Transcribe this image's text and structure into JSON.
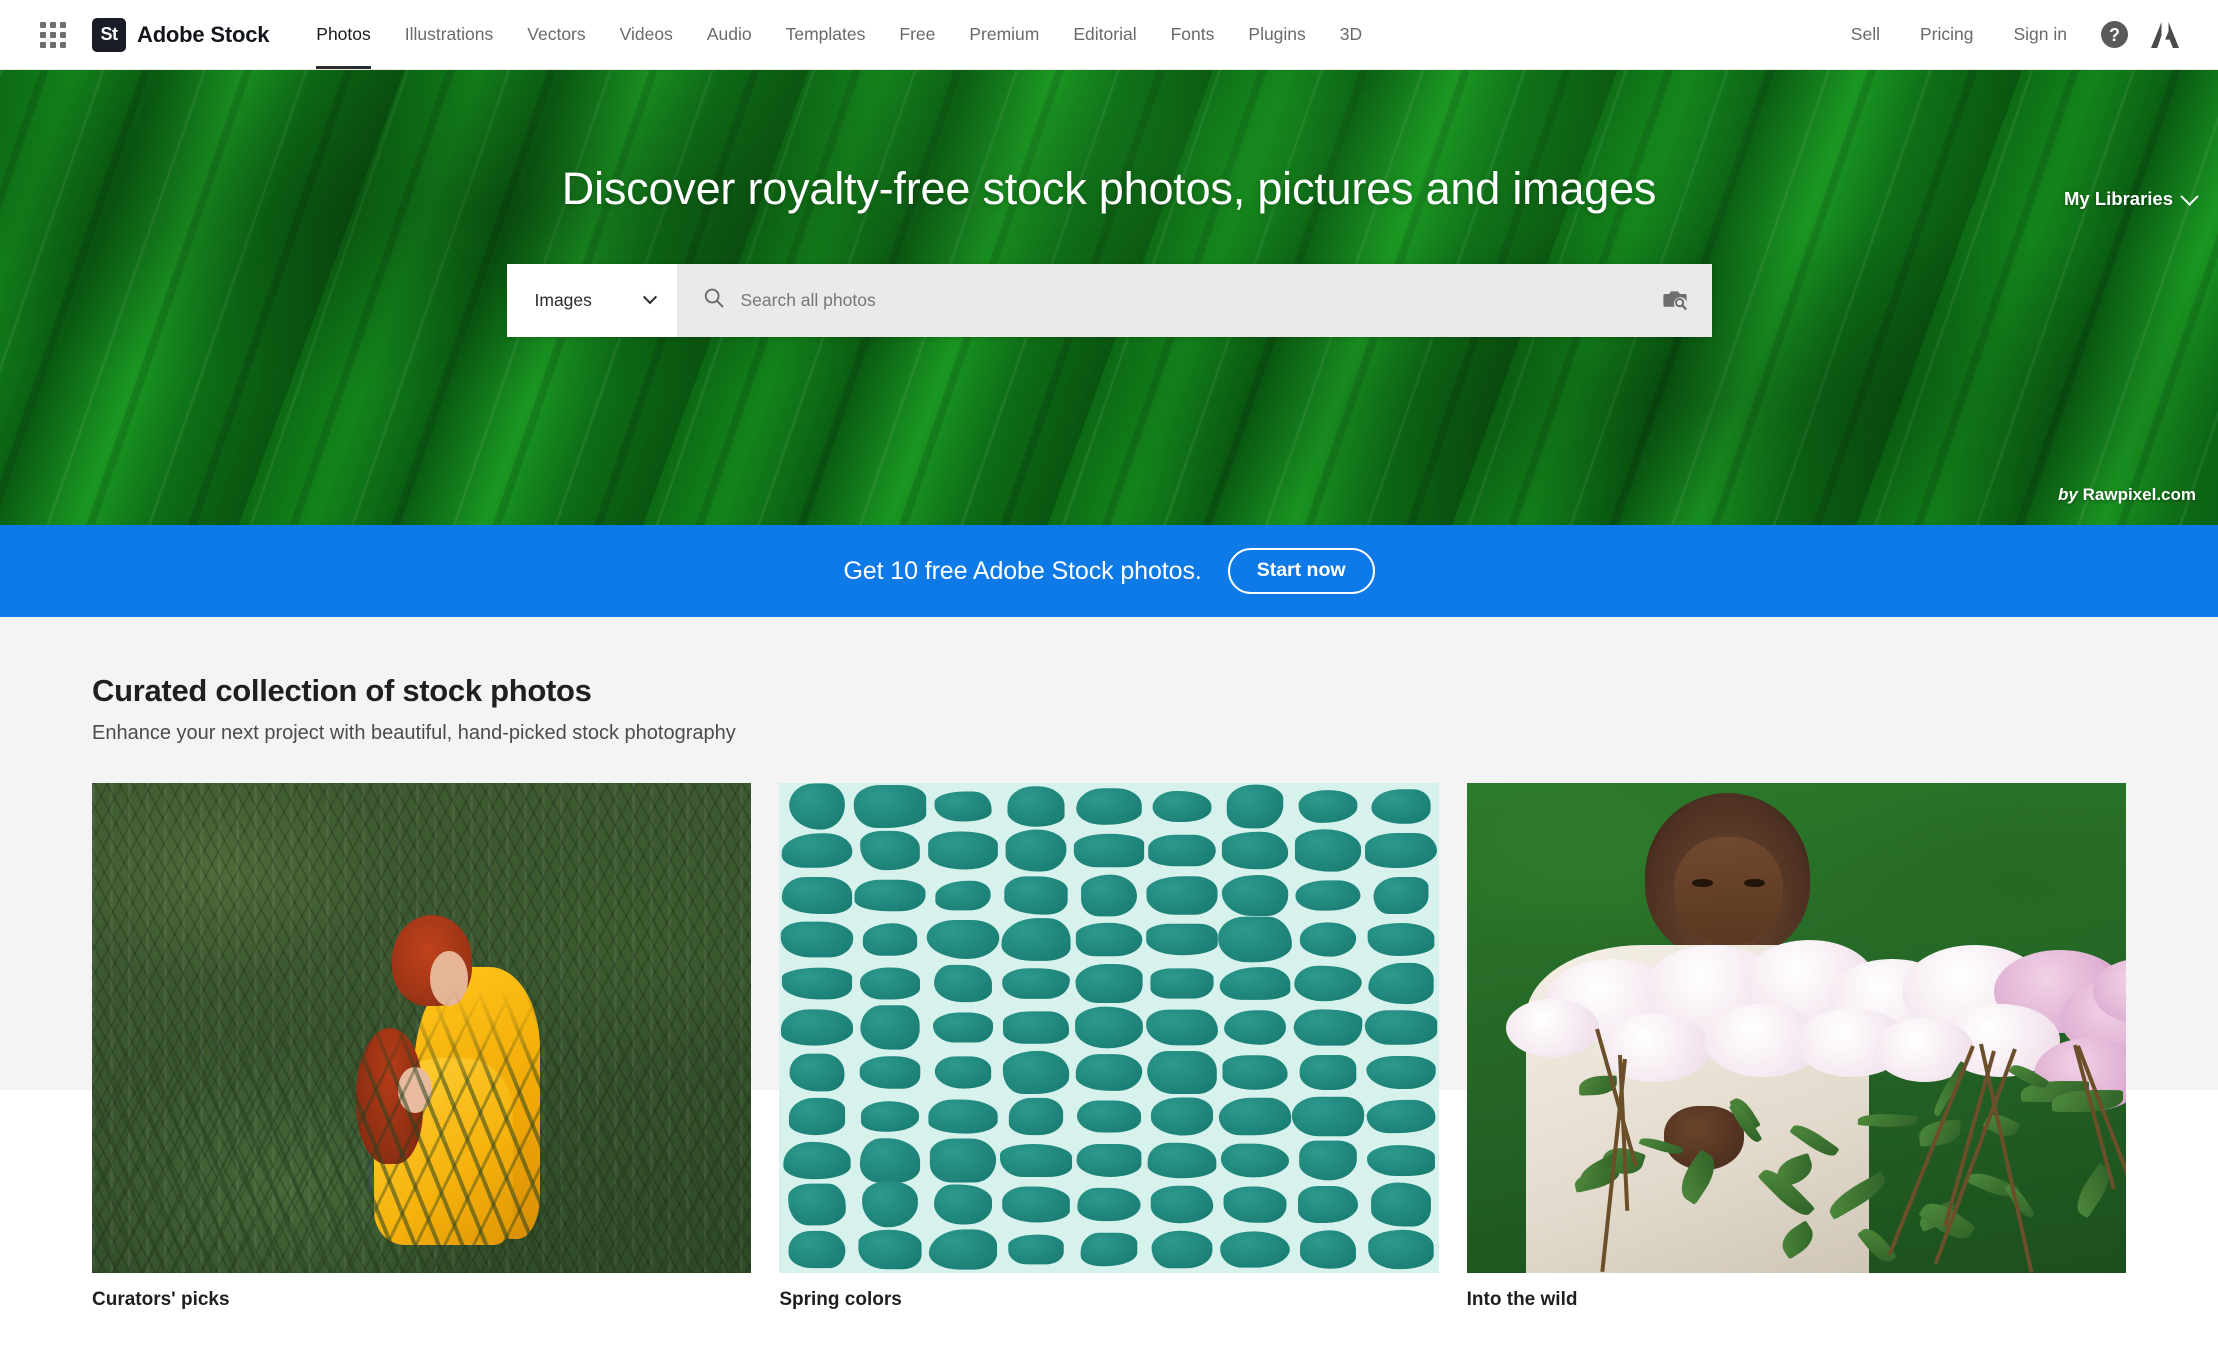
{
  "header": {
    "app_grid_icon": "app-grid-icon",
    "brand": {
      "mark": "St",
      "name": "Adobe Stock"
    },
    "nav": [
      {
        "label": "Photos",
        "active": true
      },
      {
        "label": "Illustrations",
        "active": false
      },
      {
        "label": "Vectors",
        "active": false
      },
      {
        "label": "Videos",
        "active": false
      },
      {
        "label": "Audio",
        "active": false
      },
      {
        "label": "Templates",
        "active": false
      },
      {
        "label": "Free",
        "active": false
      },
      {
        "label": "Premium",
        "active": false
      },
      {
        "label": "Editorial",
        "active": false
      },
      {
        "label": "Fonts",
        "active": false
      },
      {
        "label": "Plugins",
        "active": false
      },
      {
        "label": "3D",
        "active": false
      }
    ],
    "right_nav": [
      {
        "label": "Sell"
      },
      {
        "label": "Pricing"
      },
      {
        "label": "Sign in"
      }
    ],
    "help_icon": "?",
    "help_icon_name": "help-circle-icon",
    "adobe_logo_name": "adobe-logo-icon"
  },
  "hero": {
    "my_libraries": "My Libraries",
    "title": "Discover royalty-free stock photos, pictures and images",
    "search": {
      "type_label": "Images",
      "value": "",
      "placeholder": "Search all photos",
      "search_icon": "search-icon",
      "visual_search_icon": "camera-visual-search-icon"
    },
    "credit_by": "by",
    "credit_site": "Rawpixel.com"
  },
  "promo": {
    "text": "Get 10 free Adobe Stock photos.",
    "button": "Start now",
    "color": "#0d7ae8"
  },
  "main": {
    "section_title": "Curated collection of stock photos",
    "section_subtitle": "Enhance your next project with beautiful, hand-picked stock photography",
    "cards": [
      {
        "caption": "Curators' picks",
        "art": "ferns"
      },
      {
        "caption": "Spring colors",
        "art": "cells"
      },
      {
        "caption": "Into the wild",
        "art": "flowers"
      }
    ]
  },
  "colors": {
    "promo_blue": "#0d7ae8",
    "hero_green": "#0e7a16",
    "page_bg": "#f4f4f4",
    "text_dark": "#1f1f1f",
    "nav_gray": "#6a6a6a"
  }
}
